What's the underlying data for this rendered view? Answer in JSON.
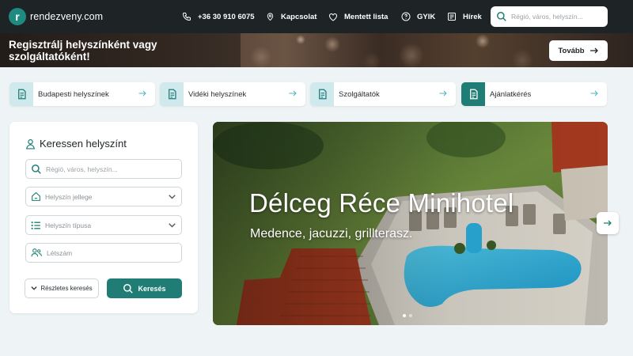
{
  "brand": {
    "name": "rendezveny.com",
    "mark": "r",
    "accent": "#1f7d75"
  },
  "nav": {
    "phone": "+36 30 910 6075",
    "contact": "Kapcsolat",
    "saved": "Mentett lista",
    "faq": "GYIK",
    "news": "Hírek",
    "search_placeholder": "Régió, város, helyszín..."
  },
  "banner": {
    "text": "Regisztrálj helyszínként vagy szolgáltatóként!",
    "button": "Tovább"
  },
  "categories": [
    {
      "label": "Budapesti helyszínek",
      "icon": "document-icon"
    },
    {
      "label": "Vidéki helyszínek",
      "icon": "document-icon"
    },
    {
      "label": "Szolgáltatók",
      "icon": "document-icon"
    },
    {
      "label": "Ajánlatkérés",
      "icon": "document-icon"
    }
  ],
  "search_panel": {
    "title": "Keressen helyszínt",
    "region_placeholder": "Régió, város, helyszín...",
    "venue_character": "Helyszín jellege",
    "venue_type": "Helyszín típusa",
    "headcount": "Létszám",
    "detail_button": "Részletes keresés",
    "search_button": "Keresés"
  },
  "hero": {
    "title": "Délceg Réce Minihotel",
    "subtitle": "Medence, jacuzzi, grillterasz.",
    "slides": 2,
    "active_slide": 1
  }
}
